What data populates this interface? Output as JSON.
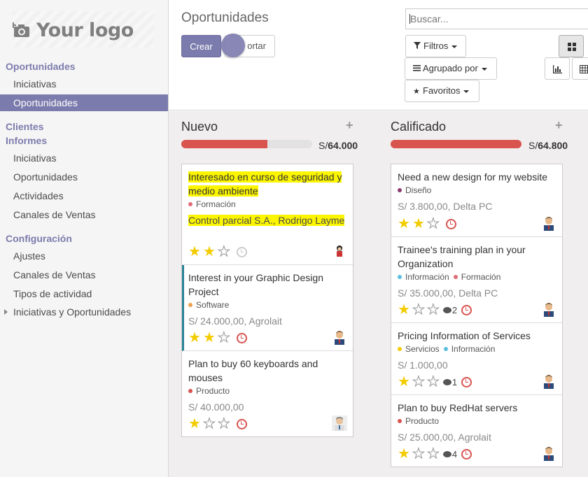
{
  "app": {
    "logo_text": "Your logo"
  },
  "sidebar": {
    "sections": [
      {
        "title": "Oportunidades",
        "items": [
          "Iniciativas",
          "Oportunidades"
        ]
      },
      {
        "title": "Clientes",
        "items": []
      },
      {
        "title": "Informes",
        "items": [
          "Iniciativas",
          "Oportunidades",
          "Actividades",
          "Canales de Ventas"
        ]
      },
      {
        "title": "Configuración",
        "items": [
          "Ajustes",
          "Canales de Ventas",
          "Tipos de actividad",
          "Iniciativas y Oportunidades"
        ]
      }
    ],
    "active_item": "Oportunidades"
  },
  "control_panel": {
    "breadcrumb": "Oportunidades",
    "create_label": "Crear",
    "import_label": "ortar",
    "search_placeholder": "Buscar...",
    "filters_label": "Filtros",
    "group_by_label": "Agrupado por",
    "favorites_label": "Favoritos"
  },
  "columns": [
    {
      "title": "Nuevo",
      "currency": "S/",
      "total": "64.000",
      "progress": 0.66,
      "cards": [
        {
          "title": "Interesado en curso de seguridad y medio ambiente",
          "tags": [
            {
              "name": "Formación",
              "color": "#e06c75"
            }
          ],
          "amount": "Control parcial S.A., Rodrigo Layme",
          "stars": 2,
          "comments": "",
          "activity": "grey",
          "highlighted": true
        },
        {
          "title": "Interest in your Graphic Design Project",
          "tags": [
            {
              "name": "Software",
              "color": "#f0a050"
            }
          ],
          "amount": "S/ 24.000,00, Agrolait",
          "stars": 2,
          "comments": "",
          "activity": "red"
        },
        {
          "title": "Plan to buy 60 keyboards and mouses",
          "tags": [
            {
              "name": "Producto",
              "color": "#d9534f"
            }
          ],
          "amount": "S/ 40.000,00",
          "stars": 1,
          "comments": "",
          "activity": "red"
        }
      ]
    },
    {
      "title": "Calificado",
      "currency": "S/",
      "total": "64.800",
      "progress": 1.0,
      "cards": [
        {
          "title": "Need a new design for my website",
          "tags": [
            {
              "name": "Diseño",
              "color": "#8a3a6e"
            }
          ],
          "amount": "S/ 3.800,00, Delta PC",
          "stars": 2,
          "comments": "",
          "activity": "red"
        },
        {
          "title": "Trainee's training plan in your Organization",
          "tags": [
            {
              "name": "Información",
              "color": "#5bc0de"
            },
            {
              "name": "Formación",
              "color": "#e06c75"
            }
          ],
          "amount": "S/ 35.000,00, Delta PC",
          "stars": 1,
          "comments": "2",
          "activity": "red"
        },
        {
          "title": "Pricing Information of Services",
          "tags": [
            {
              "name": "Servicios",
              "color": "#f3cc00"
            },
            {
              "name": "Información",
              "color": "#5bc0de"
            }
          ],
          "amount": "S/ 1.000,00",
          "stars": 1,
          "comments": "1",
          "activity": "red"
        },
        {
          "title": "Plan to buy RedHat servers",
          "tags": [
            {
              "name": "Producto",
              "color": "#d9534f"
            }
          ],
          "amount": "S/ 25.000,00, Agrolait",
          "stars": 1,
          "comments": "4",
          "activity": "red"
        }
      ]
    }
  ]
}
